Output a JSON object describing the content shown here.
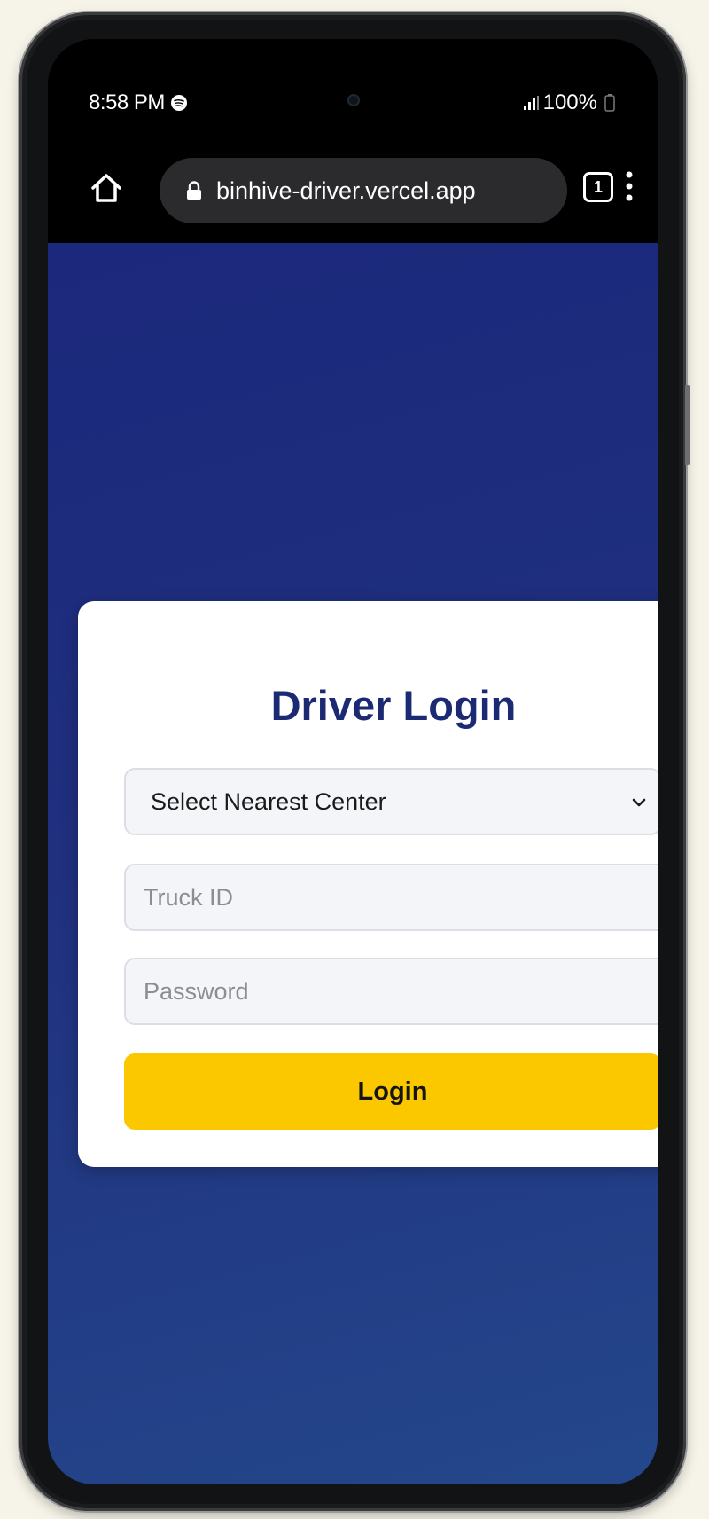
{
  "status_bar": {
    "time": "8:58 PM",
    "battery": "100%",
    "icons": [
      "spotify-icon",
      "signal-icon",
      "battery-icon"
    ]
  },
  "browser": {
    "url": "binhive-driver.vercel.app",
    "tab_count": "1",
    "icons": [
      "home-icon",
      "lock-icon",
      "tabs-icon",
      "menu-icon"
    ]
  },
  "login": {
    "title": "Driver Login",
    "center_select": {
      "selected": "Select Nearest Center"
    },
    "truck_id": {
      "placeholder": "Truck ID"
    },
    "password": {
      "placeholder": "Password"
    },
    "button_label": "Login"
  },
  "colors": {
    "page_gradient_start": "#1b287c",
    "page_gradient_end": "#24478b",
    "title": "#1c2a74",
    "button": "#fbc800"
  }
}
